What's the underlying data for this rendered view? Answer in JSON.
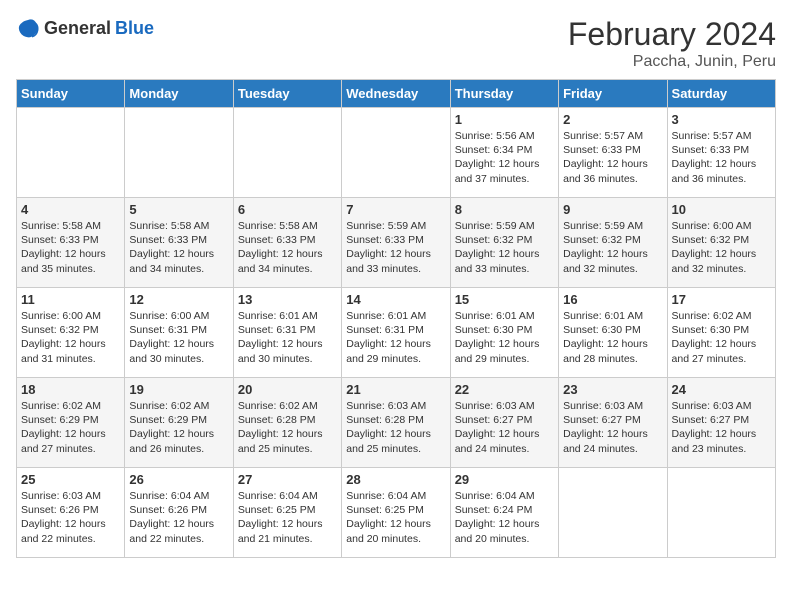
{
  "header": {
    "logo_general": "General",
    "logo_blue": "Blue",
    "main_title": "February 2024",
    "sub_title": "Paccha, Junin, Peru"
  },
  "days_of_week": [
    "Sunday",
    "Monday",
    "Tuesday",
    "Wednesday",
    "Thursday",
    "Friday",
    "Saturday"
  ],
  "weeks": [
    [
      {
        "day": "",
        "info": ""
      },
      {
        "day": "",
        "info": ""
      },
      {
        "day": "",
        "info": ""
      },
      {
        "day": "",
        "info": ""
      },
      {
        "day": "1",
        "info": "Sunrise: 5:56 AM\nSunset: 6:34 PM\nDaylight: 12 hours\nand 37 minutes."
      },
      {
        "day": "2",
        "info": "Sunrise: 5:57 AM\nSunset: 6:33 PM\nDaylight: 12 hours\nand 36 minutes."
      },
      {
        "day": "3",
        "info": "Sunrise: 5:57 AM\nSunset: 6:33 PM\nDaylight: 12 hours\nand 36 minutes."
      }
    ],
    [
      {
        "day": "4",
        "info": "Sunrise: 5:58 AM\nSunset: 6:33 PM\nDaylight: 12 hours\nand 35 minutes."
      },
      {
        "day": "5",
        "info": "Sunrise: 5:58 AM\nSunset: 6:33 PM\nDaylight: 12 hours\nand 34 minutes."
      },
      {
        "day": "6",
        "info": "Sunrise: 5:58 AM\nSunset: 6:33 PM\nDaylight: 12 hours\nand 34 minutes."
      },
      {
        "day": "7",
        "info": "Sunrise: 5:59 AM\nSunset: 6:33 PM\nDaylight: 12 hours\nand 33 minutes."
      },
      {
        "day": "8",
        "info": "Sunrise: 5:59 AM\nSunset: 6:32 PM\nDaylight: 12 hours\nand 33 minutes."
      },
      {
        "day": "9",
        "info": "Sunrise: 5:59 AM\nSunset: 6:32 PM\nDaylight: 12 hours\nand 32 minutes."
      },
      {
        "day": "10",
        "info": "Sunrise: 6:00 AM\nSunset: 6:32 PM\nDaylight: 12 hours\nand 32 minutes."
      }
    ],
    [
      {
        "day": "11",
        "info": "Sunrise: 6:00 AM\nSunset: 6:32 PM\nDaylight: 12 hours\nand 31 minutes."
      },
      {
        "day": "12",
        "info": "Sunrise: 6:00 AM\nSunset: 6:31 PM\nDaylight: 12 hours\nand 30 minutes."
      },
      {
        "day": "13",
        "info": "Sunrise: 6:01 AM\nSunset: 6:31 PM\nDaylight: 12 hours\nand 30 minutes."
      },
      {
        "day": "14",
        "info": "Sunrise: 6:01 AM\nSunset: 6:31 PM\nDaylight: 12 hours\nand 29 minutes."
      },
      {
        "day": "15",
        "info": "Sunrise: 6:01 AM\nSunset: 6:30 PM\nDaylight: 12 hours\nand 29 minutes."
      },
      {
        "day": "16",
        "info": "Sunrise: 6:01 AM\nSunset: 6:30 PM\nDaylight: 12 hours\nand 28 minutes."
      },
      {
        "day": "17",
        "info": "Sunrise: 6:02 AM\nSunset: 6:30 PM\nDaylight: 12 hours\nand 27 minutes."
      }
    ],
    [
      {
        "day": "18",
        "info": "Sunrise: 6:02 AM\nSunset: 6:29 PM\nDaylight: 12 hours\nand 27 minutes."
      },
      {
        "day": "19",
        "info": "Sunrise: 6:02 AM\nSunset: 6:29 PM\nDaylight: 12 hours\nand 26 minutes."
      },
      {
        "day": "20",
        "info": "Sunrise: 6:02 AM\nSunset: 6:28 PM\nDaylight: 12 hours\nand 25 minutes."
      },
      {
        "day": "21",
        "info": "Sunrise: 6:03 AM\nSunset: 6:28 PM\nDaylight: 12 hours\nand 25 minutes."
      },
      {
        "day": "22",
        "info": "Sunrise: 6:03 AM\nSunset: 6:27 PM\nDaylight: 12 hours\nand 24 minutes."
      },
      {
        "day": "23",
        "info": "Sunrise: 6:03 AM\nSunset: 6:27 PM\nDaylight: 12 hours\nand 24 minutes."
      },
      {
        "day": "24",
        "info": "Sunrise: 6:03 AM\nSunset: 6:27 PM\nDaylight: 12 hours\nand 23 minutes."
      }
    ],
    [
      {
        "day": "25",
        "info": "Sunrise: 6:03 AM\nSunset: 6:26 PM\nDaylight: 12 hours\nand 22 minutes."
      },
      {
        "day": "26",
        "info": "Sunrise: 6:04 AM\nSunset: 6:26 PM\nDaylight: 12 hours\nand 22 minutes."
      },
      {
        "day": "27",
        "info": "Sunrise: 6:04 AM\nSunset: 6:25 PM\nDaylight: 12 hours\nand 21 minutes."
      },
      {
        "day": "28",
        "info": "Sunrise: 6:04 AM\nSunset: 6:25 PM\nDaylight: 12 hours\nand 20 minutes."
      },
      {
        "day": "29",
        "info": "Sunrise: 6:04 AM\nSunset: 6:24 PM\nDaylight: 12 hours\nand 20 minutes."
      },
      {
        "day": "",
        "info": ""
      },
      {
        "day": "",
        "info": ""
      }
    ]
  ]
}
